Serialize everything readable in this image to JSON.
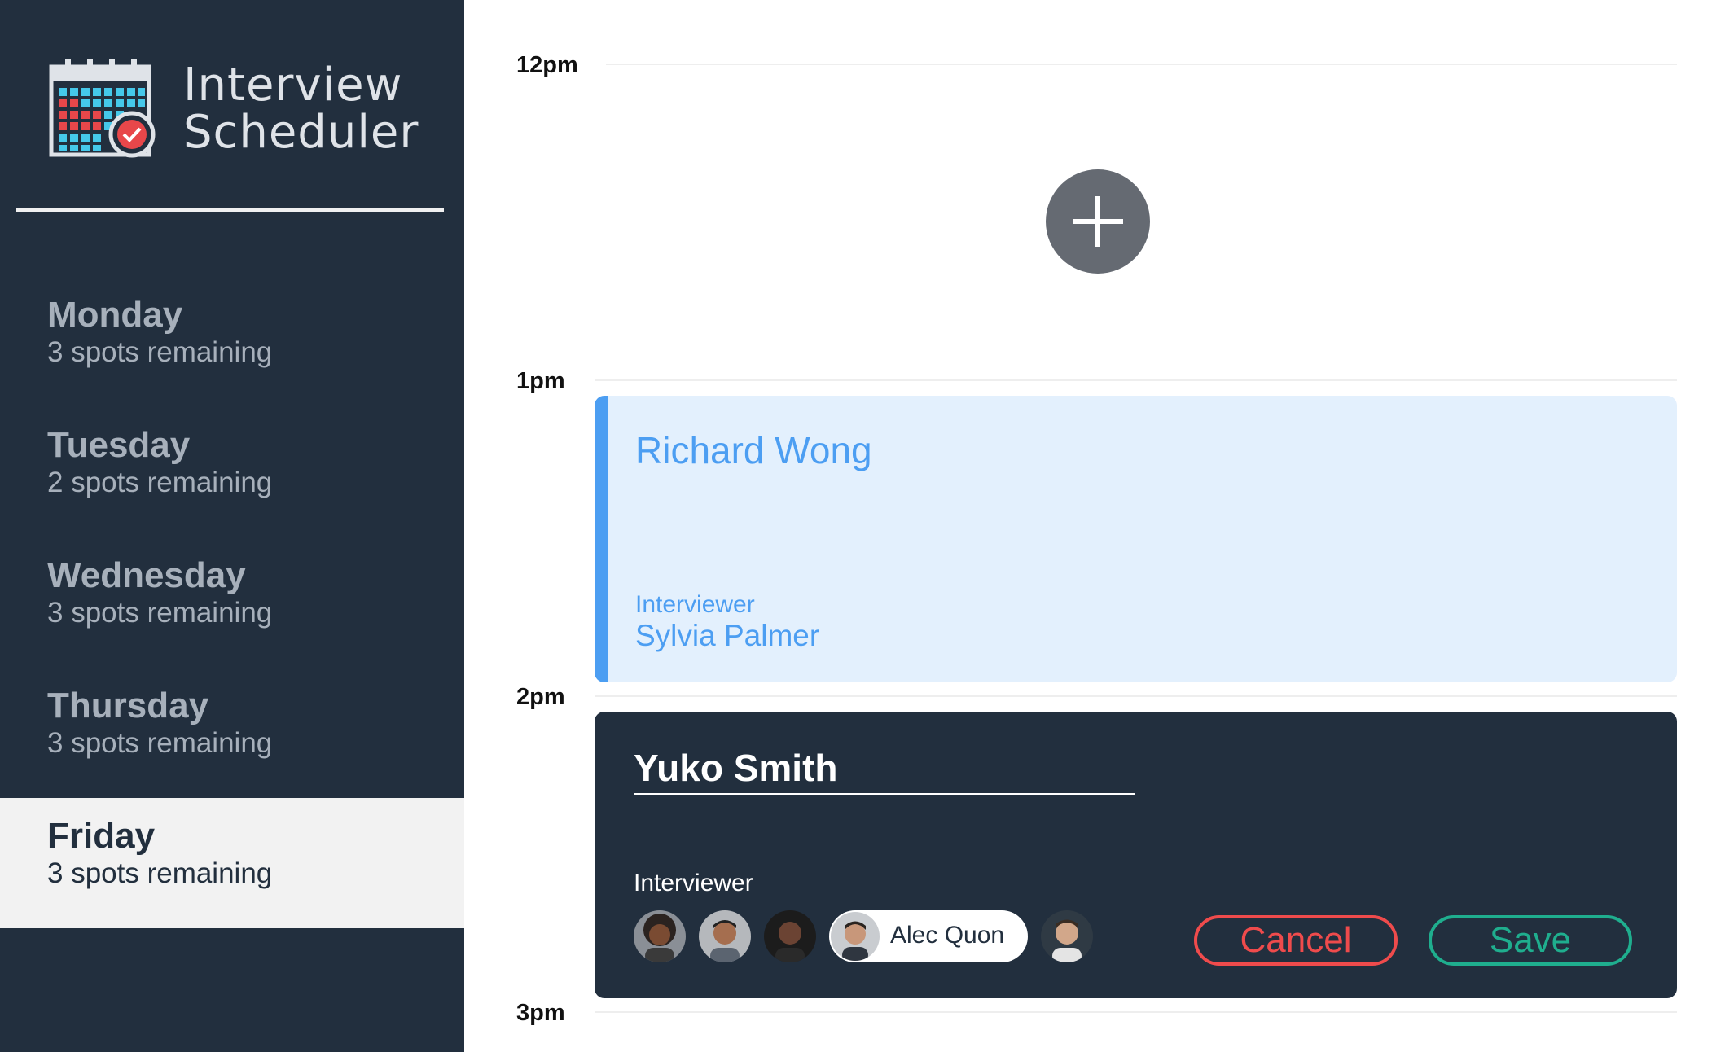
{
  "app": {
    "title_line1": "Interview",
    "title_line2": "Scheduler",
    "logo_icon": "calendar-check-icon"
  },
  "days": [
    {
      "name": "Monday",
      "spots": "3 spots remaining",
      "selected": false
    },
    {
      "name": "Tuesday",
      "spots": "2 spots remaining",
      "selected": false
    },
    {
      "name": "Wednesday",
      "spots": "3 spots remaining",
      "selected": false
    },
    {
      "name": "Thursday",
      "spots": "3 spots remaining",
      "selected": false
    },
    {
      "name": "Friday",
      "spots": "3 spots remaining",
      "selected": true
    }
  ],
  "times": [
    "12pm",
    "1pm",
    "2pm",
    "3pm"
  ],
  "add_button_icon": "plus-icon",
  "appointment": {
    "student": "Richard Wong",
    "interviewer_label": "Interviewer",
    "interviewer": "Sylvia Palmer"
  },
  "form": {
    "student_value": "Yuko Smith",
    "interviewer_label": "Interviewer",
    "selected_interviewer": "Alec Quon",
    "cancel_label": "Cancel",
    "save_label": "Save"
  },
  "colors": {
    "sidebar_bg": "#222f3e",
    "appointment_bg": "#e3f0fd",
    "appointment_accent": "#4c9ef2",
    "cancel": "#ef4b4c",
    "save": "#1fae8e"
  }
}
